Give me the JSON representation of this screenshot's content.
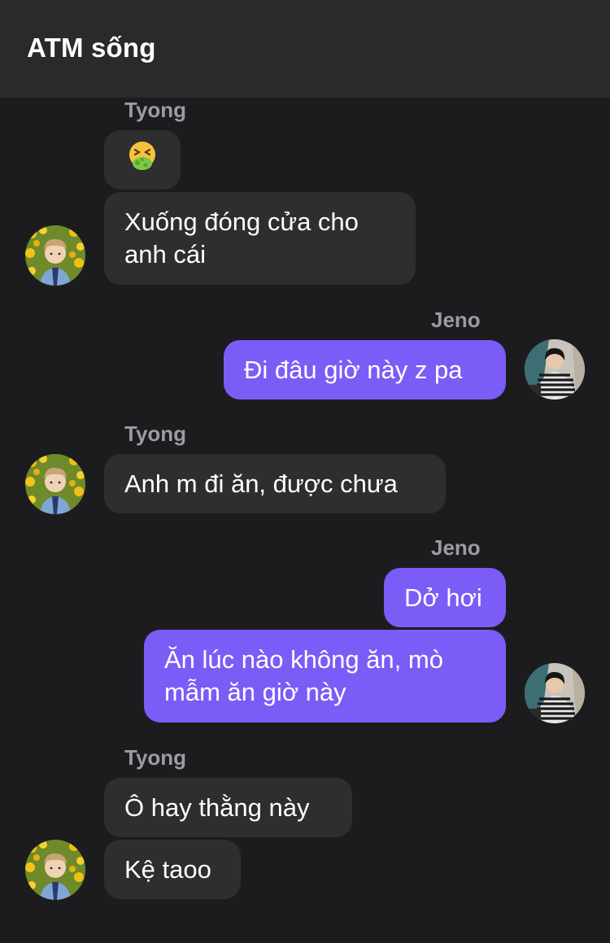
{
  "header": {
    "title": "ATM sống"
  },
  "messages": {
    "g1": {
      "sender": "Tyong",
      "emoji_icon": "nauseated-face-icon",
      "text1": "Xuống đóng cửa cho anh cái"
    },
    "g2": {
      "sender": "Jeno",
      "text1": "Đi đâu giờ này z pa"
    },
    "g3": {
      "sender": "Tyong",
      "text1": "Anh m đi ăn, được chưa"
    },
    "g4": {
      "sender": "Jeno",
      "text1": "Dở hơi",
      "text2": "Ăn lúc nào không ăn, mò mẫm ăn giờ này"
    },
    "g5": {
      "sender": "Tyong",
      "text1": "Ô hay thằng này",
      "text2": "Kệ taoo"
    }
  },
  "colors": {
    "background": "#1c1c1e",
    "header": "#2a2a2c",
    "incoming_bubble": "#2e2e30",
    "outgoing_bubble": "#7b5cf6",
    "sender_name": "#9b9ba1"
  }
}
